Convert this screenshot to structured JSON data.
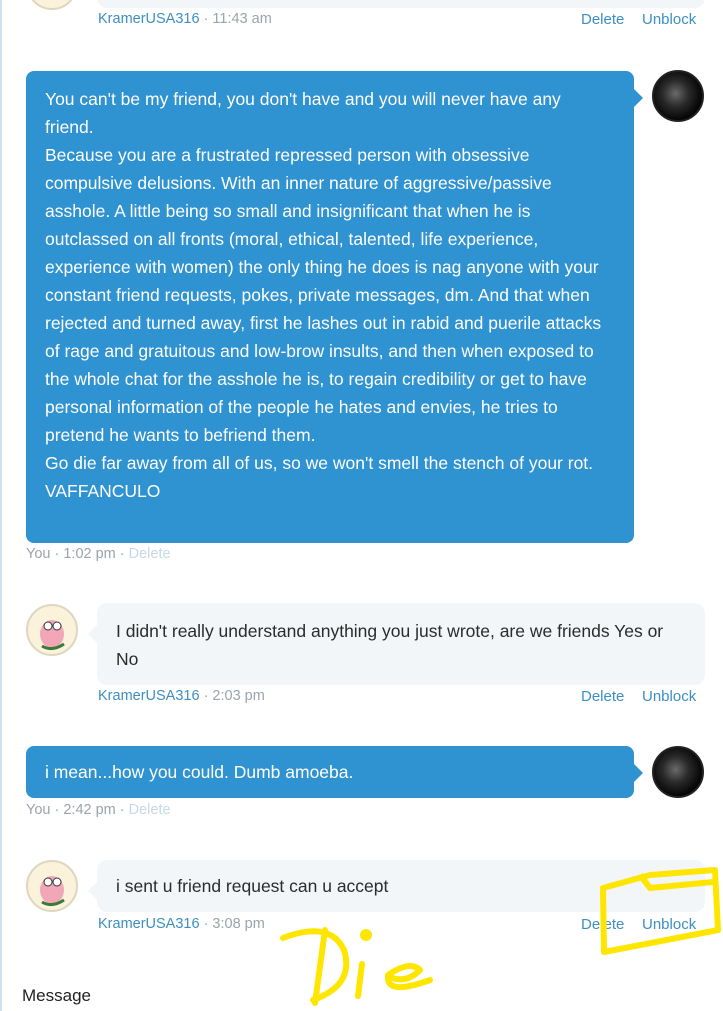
{
  "chat": {
    "partner_name": "KramerUSA316",
    "self_name": "You",
    "actions": {
      "delete": "Delete",
      "unblock": "Unblock"
    },
    "top_meta": {
      "sender": "KramerUSA316",
      "time": "· 11:43 am"
    },
    "messages": [
      {
        "from": "you",
        "paragraphs": [
          "You can't be my friend, you don't have and you will never have any friend.",
          "Because you are a frustrated repressed person with obsessive compulsive delusions. With an inner nature of aggressive/passive asshole. A little being so small and insignificant that when he is outclassed on all fronts (moral, ethical, talented, life experience, experience with women) the only thing he does is nag anyone with your constant friend requests, pokes, private messages, dm. And that when rejected and turned away, first he lashes out in rabid and puerile attacks of rage and gratuitous and low-brow insults, and then when exposed to the whole chat for the asshole he is, to regain credibility or get to have personal information of the people he hates and envies, he tries to pretend he wants to befriend them.",
          "Go die far away from all of us, so we won't smell the stench of your rot.",
          "VAFFANCULO"
        ],
        "sender": "You",
        "time": "· 1:02 pm ·"
      },
      {
        "from": "partner",
        "text": "I didn't really understand anything you just wrote, are we friends Yes or No",
        "sender": "KramerUSA316",
        "time": "· 2:03 pm"
      },
      {
        "from": "you",
        "text": "i mean...how you could. Dumb amoeba.",
        "sender": "You",
        "time": "· 2:42 pm ·"
      },
      {
        "from": "partner",
        "text": "i sent u friend request can u accept",
        "sender": "KramerUSA316",
        "time": "· 3:08 pm"
      }
    ],
    "composer_label": "Message"
  },
  "annotation": {
    "scrawl_text": "Die",
    "color": "#ffe600"
  },
  "colors": {
    "outgoing_bubble": "#2f92d1",
    "incoming_bubble": "#f3f6f8",
    "link": "#3d8fc3",
    "meta_gray": "#9aa4ab"
  }
}
